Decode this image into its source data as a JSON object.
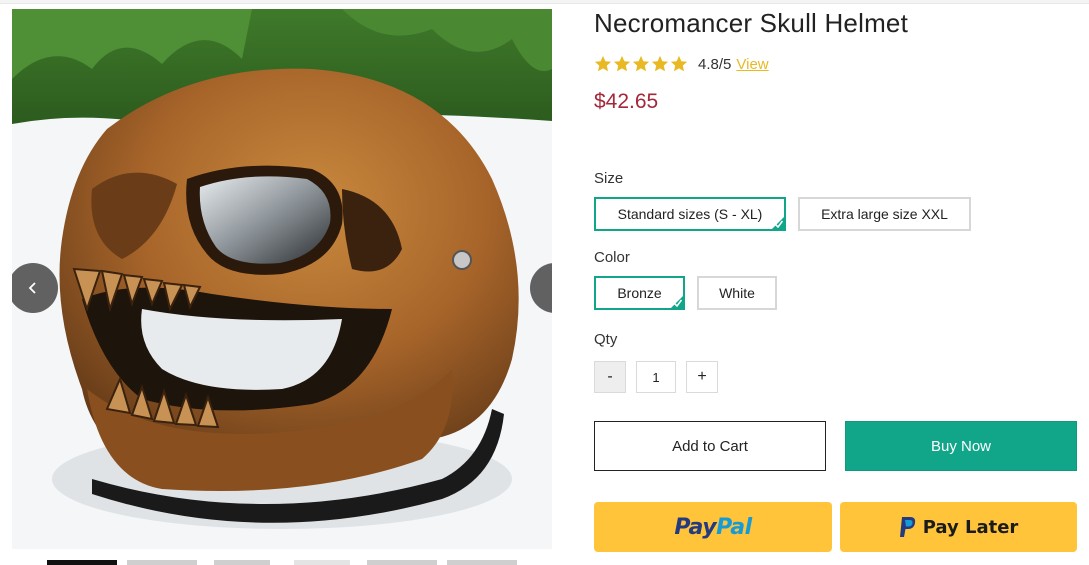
{
  "product": {
    "title": "Necromancer Skull Helmet",
    "rating_score": "4.8/5",
    "rating_link": "View",
    "rating_value": 4.8,
    "price": "$42.65"
  },
  "gallery": {
    "image_alt": "product-photo-bronze-skull-helmet",
    "prev_icon": "chevron-left-icon",
    "next_icon": "chevron-right-icon",
    "thumbnail_count": 6,
    "active_thumbnail": 0
  },
  "options": {
    "size": {
      "label": "Size",
      "choices": [
        "Standard sizes (S - XL)",
        "Extra large size XXL"
      ],
      "selected": "Standard sizes (S - XL)"
    },
    "color": {
      "label": "Color",
      "choices": [
        "Bronze",
        "White"
      ],
      "selected": "Bronze"
    }
  },
  "quantity": {
    "label": "Qty",
    "minus": "-",
    "plus": "+",
    "value": "1"
  },
  "actions": {
    "add_to_cart": "Add to Cart",
    "buy_now": "Buy Now",
    "paypal_pay": "Pay",
    "paypal_pal": "Pal",
    "paylater": "Pay Later"
  },
  "colors": {
    "accent_green": "#11a58a",
    "price_red": "#a4273a",
    "star_gold": "#e8b923",
    "paypal_yellow": "#ffc439",
    "paypal_dark_blue": "#253b80",
    "paypal_light_blue": "#179bd7"
  }
}
